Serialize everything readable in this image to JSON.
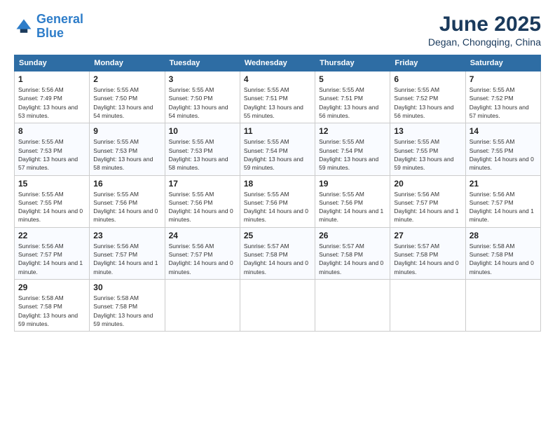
{
  "logo": {
    "line1": "General",
    "line2": "Blue"
  },
  "title": "June 2025",
  "location": "Degan, Chongqing, China",
  "days_of_week": [
    "Sunday",
    "Monday",
    "Tuesday",
    "Wednesday",
    "Thursday",
    "Friday",
    "Saturday"
  ],
  "weeks": [
    [
      {
        "num": "1",
        "rise": "Sunrise: 5:56 AM",
        "set": "Sunset: 7:49 PM",
        "daylight": "Daylight: 13 hours and 53 minutes."
      },
      {
        "num": "2",
        "rise": "Sunrise: 5:55 AM",
        "set": "Sunset: 7:50 PM",
        "daylight": "Daylight: 13 hours and 54 minutes."
      },
      {
        "num": "3",
        "rise": "Sunrise: 5:55 AM",
        "set": "Sunset: 7:50 PM",
        "daylight": "Daylight: 13 hours and 54 minutes."
      },
      {
        "num": "4",
        "rise": "Sunrise: 5:55 AM",
        "set": "Sunset: 7:51 PM",
        "daylight": "Daylight: 13 hours and 55 minutes."
      },
      {
        "num": "5",
        "rise": "Sunrise: 5:55 AM",
        "set": "Sunset: 7:51 PM",
        "daylight": "Daylight: 13 hours and 56 minutes."
      },
      {
        "num": "6",
        "rise": "Sunrise: 5:55 AM",
        "set": "Sunset: 7:52 PM",
        "daylight": "Daylight: 13 hours and 56 minutes."
      },
      {
        "num": "7",
        "rise": "Sunrise: 5:55 AM",
        "set": "Sunset: 7:52 PM",
        "daylight": "Daylight: 13 hours and 57 minutes."
      }
    ],
    [
      {
        "num": "8",
        "rise": "Sunrise: 5:55 AM",
        "set": "Sunset: 7:53 PM",
        "daylight": "Daylight: 13 hours and 57 minutes."
      },
      {
        "num": "9",
        "rise": "Sunrise: 5:55 AM",
        "set": "Sunset: 7:53 PM",
        "daylight": "Daylight: 13 hours and 58 minutes."
      },
      {
        "num": "10",
        "rise": "Sunrise: 5:55 AM",
        "set": "Sunset: 7:53 PM",
        "daylight": "Daylight: 13 hours and 58 minutes."
      },
      {
        "num": "11",
        "rise": "Sunrise: 5:55 AM",
        "set": "Sunset: 7:54 PM",
        "daylight": "Daylight: 13 hours and 59 minutes."
      },
      {
        "num": "12",
        "rise": "Sunrise: 5:55 AM",
        "set": "Sunset: 7:54 PM",
        "daylight": "Daylight: 13 hours and 59 minutes."
      },
      {
        "num": "13",
        "rise": "Sunrise: 5:55 AM",
        "set": "Sunset: 7:55 PM",
        "daylight": "Daylight: 13 hours and 59 minutes."
      },
      {
        "num": "14",
        "rise": "Sunrise: 5:55 AM",
        "set": "Sunset: 7:55 PM",
        "daylight": "Daylight: 14 hours and 0 minutes."
      }
    ],
    [
      {
        "num": "15",
        "rise": "Sunrise: 5:55 AM",
        "set": "Sunset: 7:55 PM",
        "daylight": "Daylight: 14 hours and 0 minutes."
      },
      {
        "num": "16",
        "rise": "Sunrise: 5:55 AM",
        "set": "Sunset: 7:56 PM",
        "daylight": "Daylight: 14 hours and 0 minutes."
      },
      {
        "num": "17",
        "rise": "Sunrise: 5:55 AM",
        "set": "Sunset: 7:56 PM",
        "daylight": "Daylight: 14 hours and 0 minutes."
      },
      {
        "num": "18",
        "rise": "Sunrise: 5:55 AM",
        "set": "Sunset: 7:56 PM",
        "daylight": "Daylight: 14 hours and 0 minutes."
      },
      {
        "num": "19",
        "rise": "Sunrise: 5:55 AM",
        "set": "Sunset: 7:56 PM",
        "daylight": "Daylight: 14 hours and 1 minute."
      },
      {
        "num": "20",
        "rise": "Sunrise: 5:56 AM",
        "set": "Sunset: 7:57 PM",
        "daylight": "Daylight: 14 hours and 1 minute."
      },
      {
        "num": "21",
        "rise": "Sunrise: 5:56 AM",
        "set": "Sunset: 7:57 PM",
        "daylight": "Daylight: 14 hours and 1 minute."
      }
    ],
    [
      {
        "num": "22",
        "rise": "Sunrise: 5:56 AM",
        "set": "Sunset: 7:57 PM",
        "daylight": "Daylight: 14 hours and 1 minute."
      },
      {
        "num": "23",
        "rise": "Sunrise: 5:56 AM",
        "set": "Sunset: 7:57 PM",
        "daylight": "Daylight: 14 hours and 1 minute."
      },
      {
        "num": "24",
        "rise": "Sunrise: 5:56 AM",
        "set": "Sunset: 7:57 PM",
        "daylight": "Daylight: 14 hours and 0 minutes."
      },
      {
        "num": "25",
        "rise": "Sunrise: 5:57 AM",
        "set": "Sunset: 7:58 PM",
        "daylight": "Daylight: 14 hours and 0 minutes."
      },
      {
        "num": "26",
        "rise": "Sunrise: 5:57 AM",
        "set": "Sunset: 7:58 PM",
        "daylight": "Daylight: 14 hours and 0 minutes."
      },
      {
        "num": "27",
        "rise": "Sunrise: 5:57 AM",
        "set": "Sunset: 7:58 PM",
        "daylight": "Daylight: 14 hours and 0 minutes."
      },
      {
        "num": "28",
        "rise": "Sunrise: 5:58 AM",
        "set": "Sunset: 7:58 PM",
        "daylight": "Daylight: 14 hours and 0 minutes."
      }
    ],
    [
      {
        "num": "29",
        "rise": "Sunrise: 5:58 AM",
        "set": "Sunset: 7:58 PM",
        "daylight": "Daylight: 13 hours and 59 minutes."
      },
      {
        "num": "30",
        "rise": "Sunrise: 5:58 AM",
        "set": "Sunset: 7:58 PM",
        "daylight": "Daylight: 13 hours and 59 minutes."
      },
      null,
      null,
      null,
      null,
      null
    ]
  ]
}
